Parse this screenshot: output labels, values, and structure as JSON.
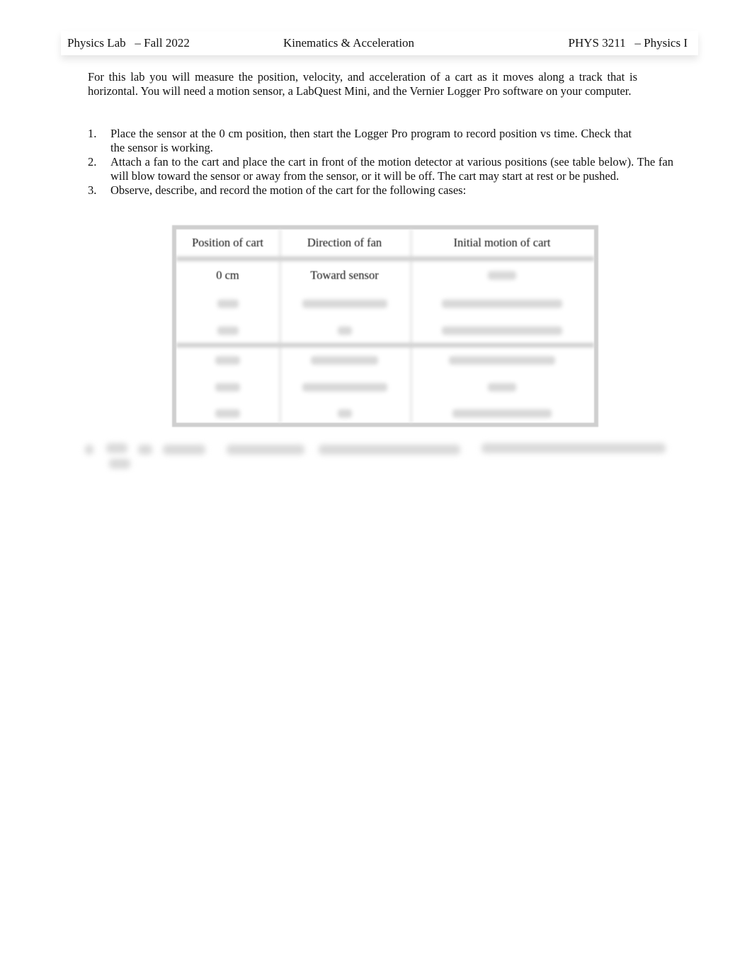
{
  "header": {
    "left": "Physics Lab   – Fall 2022",
    "center": "Kinematics & Acceleration",
    "right": "PHYS 3211   – Physics I"
  },
  "intro": "For this lab you will measure the position, velocity, and acceleration of a cart as it moves along a track that is horizontal.    You will need a motion sensor, a LabQuest Mini, and the Vernier Logger Pro software on your computer.",
  "steps": [
    {
      "num": "1.",
      "text": "Place the sensor at the 0 cm position, then start the Logger Pro program to record position vs time. Check that the sensor is working."
    },
    {
      "num": "2.",
      "text": "Attach a fan to the cart and place the cart in front of the motion detector at various positions (see table below).   The fan will blow toward the sensor or away from the sensor, or it will be off.          The cart may start at rest or be pushed."
    },
    {
      "num": "3.",
      "text": "Observe, describe, and record the motion of the cart for the following cases:"
    }
  ],
  "table": {
    "headers": [
      "Position of cart",
      "Direction of fan",
      "Initial motion of cart"
    ],
    "rows": [
      [
        "0 cm",
        "Toward sensor",
        ""
      ],
      [
        "",
        "",
        ""
      ],
      [
        "",
        "",
        ""
      ],
      [
        "",
        "",
        ""
      ],
      [
        "",
        "",
        ""
      ],
      [
        "",
        "",
        ""
      ]
    ]
  }
}
